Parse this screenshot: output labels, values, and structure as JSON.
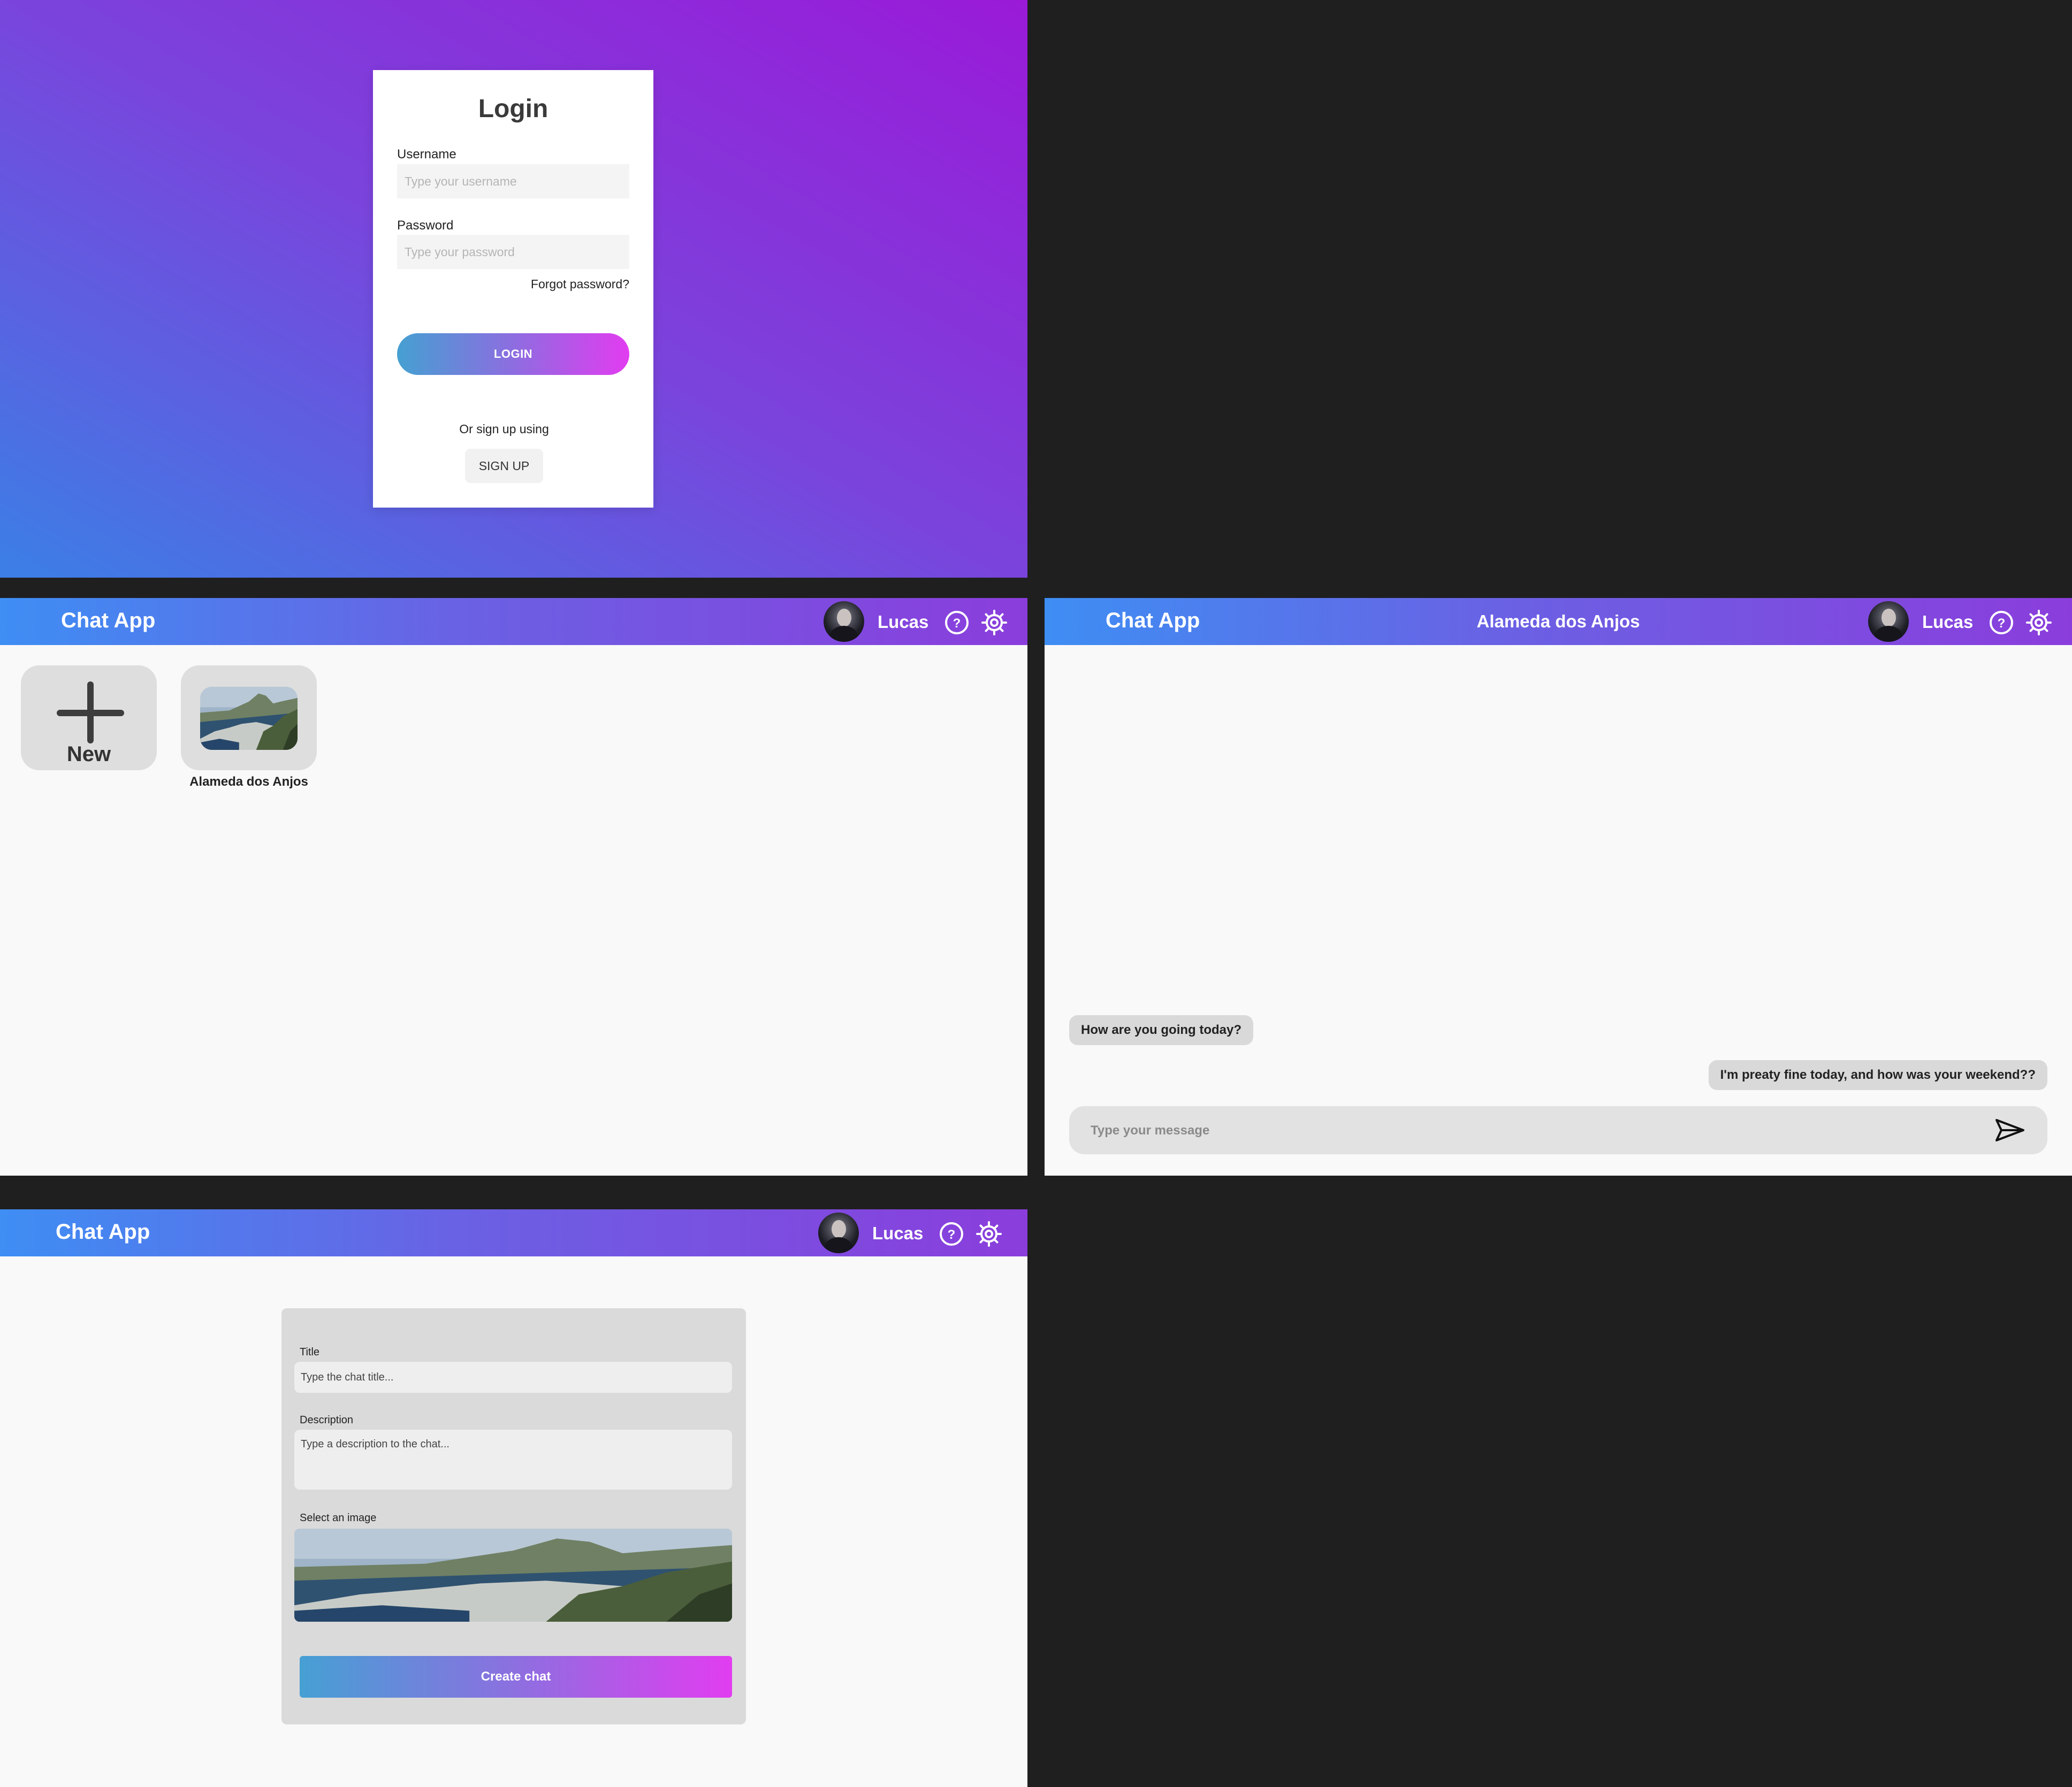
{
  "login": {
    "title": "Login",
    "username_label": "Username",
    "username_placeholder": "Type your username",
    "password_label": "Password",
    "password_placeholder": "Type your password",
    "forgot_password": "Forgot password?",
    "login_button": "LOGIN",
    "signup_text": "Or sign up using",
    "signup_button": "SIGN UP"
  },
  "header": {
    "app_title": "Chat App",
    "user_name": "Lucas",
    "avatar_icon": "user-avatar",
    "help_icon": "question-circle-icon",
    "settings_icon": "gear-icon"
  },
  "chat_list": {
    "new_label": "New",
    "chats": [
      {
        "title": "Alameda dos Anjos",
        "image": "landscape-thumbnail"
      }
    ]
  },
  "chat_room": {
    "chat_title": "Alameda dos Anjos",
    "messages": [
      {
        "direction": "incoming",
        "text": "How are you going today?"
      },
      {
        "direction": "outgoing",
        "text": "I'm preaty fine today, and how was your weekend??"
      }
    ],
    "input_placeholder": "Type your message",
    "send_icon": "send-icon"
  },
  "new_chat": {
    "title_label": "Title",
    "title_placeholder": "Type the chat title...",
    "description_label": "Description",
    "description_placeholder": "Type a description to the chat...",
    "image_label": "Select an image",
    "create_button": "Create chat"
  },
  "colors": {
    "background": "#1f1f1f",
    "gradient_blue": "#3e8ef4",
    "gradient_purple": "#8b3ddc",
    "button_pink": "#e23cf0",
    "surface": "#f9f9f9"
  }
}
